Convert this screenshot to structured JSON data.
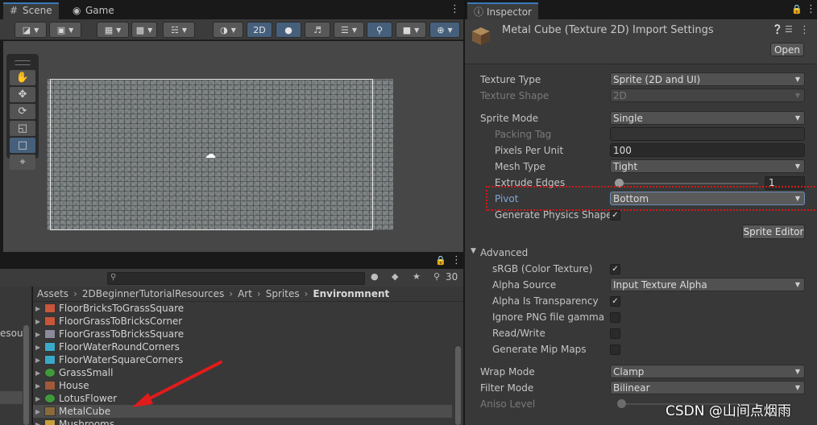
{
  "scene_panel": {
    "tabs": [
      {
        "label": "Scene",
        "icon": "grid-icon"
      },
      {
        "label": "Game",
        "icon": "gamepad-icon"
      }
    ],
    "toolbar": {
      "mode_2d_label": "2D"
    }
  },
  "project_panel": {
    "hidden_count": "30",
    "left_label": "esou",
    "breadcrumb": [
      "Assets",
      "2DBeginnerTutorialResources",
      "Art",
      "Sprites",
      "Environmnent"
    ],
    "files": [
      {
        "name": "FloorBricksToGrassSquare",
        "icon_color": "#c9553a"
      },
      {
        "name": "FloorGrassToBricksCorner",
        "icon_color": "#c9553a"
      },
      {
        "name": "FloorGrassToBricksSquare",
        "icon_color": "#8a8a9a"
      },
      {
        "name": "FloorWaterRoundCorners",
        "icon_color": "#3aa9c9"
      },
      {
        "name": "FloorWaterSquareCorners",
        "icon_color": "#3aa9c9"
      },
      {
        "name": "GrassSmall",
        "icon_color": "#3f9a3a"
      },
      {
        "name": "House",
        "icon_color": "#a05a3a"
      },
      {
        "name": "LotusFlower",
        "icon_color": "#3f9a3a"
      },
      {
        "name": "MetalCube",
        "icon_color": "#8a6a3a"
      },
      {
        "name": "Mushrooms",
        "icon_color": "#c9a03a"
      }
    ]
  },
  "inspector": {
    "tab_label": "Inspector",
    "title": "Metal Cube (Texture 2D) Import Settings",
    "open_button": "Open",
    "properties": {
      "texture_type": {
        "label": "Texture Type",
        "value": "Sprite (2D and UI)"
      },
      "texture_shape": {
        "label": "Texture Shape",
        "value": "2D"
      },
      "sprite_mode": {
        "label": "Sprite Mode",
        "value": "Single"
      },
      "packing_tag": {
        "label": "Packing Tag",
        "value": ""
      },
      "pixels_per_unit": {
        "label": "Pixels Per Unit",
        "value": "100"
      },
      "mesh_type": {
        "label": "Mesh Type",
        "value": "Tight"
      },
      "extrude_edges": {
        "label": "Extrude Edges",
        "value": "1"
      },
      "pivot": {
        "label": "Pivot",
        "value": "Bottom"
      },
      "generate_physics_shape": {
        "label": "Generate Physics Shape",
        "checked": true
      },
      "sprite_editor_button": "Sprite Editor"
    },
    "advanced": {
      "label": "Advanced",
      "srgb": {
        "label": "sRGB (Color Texture)",
        "checked": true
      },
      "alpha_source": {
        "label": "Alpha Source",
        "value": "Input Texture Alpha"
      },
      "alpha_is_transparency": {
        "label": "Alpha Is Transparency",
        "checked": true
      },
      "ignore_png_gamma": {
        "label": "Ignore PNG file gamma",
        "checked": false
      },
      "read_write": {
        "label": "Read/Write",
        "checked": false
      },
      "generate_mip_maps": {
        "label": "Generate Mip Maps",
        "checked": false
      }
    },
    "wrap_mode": {
      "label": "Wrap Mode",
      "value": "Clamp"
    },
    "filter_mode": {
      "label": "Filter Mode",
      "value": "Bilinear"
    },
    "aniso_level": {
      "label": "Aniso Level"
    }
  },
  "watermark": "CSDN @山间点烟雨",
  "colors": {
    "accent_blue": "#3a79bb",
    "annotation_red": "#d41a1a"
  }
}
